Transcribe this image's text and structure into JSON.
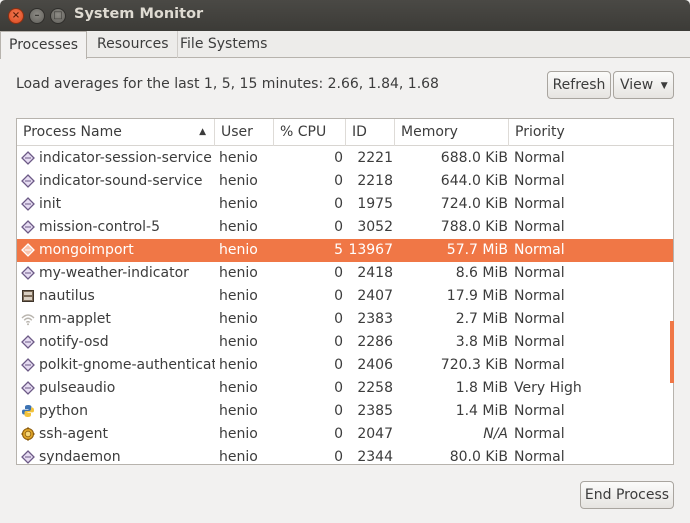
{
  "window": {
    "title": "System Monitor"
  },
  "tabs": [
    {
      "label": "Processes",
      "active": true
    },
    {
      "label": "Resources",
      "active": false
    },
    {
      "label": "File Systems",
      "active": false
    }
  ],
  "load_averages": "Load averages for the last 1, 5, 15 minutes: 2.66, 1.84, 1.68",
  "toolbar": {
    "refresh_label": "Refresh",
    "view_label": "View"
  },
  "columns": {
    "name": "Process Name",
    "user": "User",
    "cpu": "% CPU",
    "id": "ID",
    "memory": "Memory",
    "priority": "Priority"
  },
  "processes": [
    {
      "name": "indicator-session-service",
      "user": "henio",
      "cpu": "0",
      "id": "2221",
      "memory": "688.0 KiB",
      "priority": "Normal",
      "icon": "diamond-icon"
    },
    {
      "name": "indicator-sound-service",
      "user": "henio",
      "cpu": "0",
      "id": "2218",
      "memory": "644.0 KiB",
      "priority": "Normal",
      "icon": "diamond-icon"
    },
    {
      "name": "init",
      "user": "henio",
      "cpu": "0",
      "id": "1975",
      "memory": "724.0 KiB",
      "priority": "Normal",
      "icon": "diamond-icon"
    },
    {
      "name": "mission-control-5",
      "user": "henio",
      "cpu": "0",
      "id": "3052",
      "memory": "788.0 KiB",
      "priority": "Normal",
      "icon": "diamond-icon"
    },
    {
      "name": "mongoimport",
      "user": "henio",
      "cpu": "5",
      "id": "13967",
      "memory": "57.7 MiB",
      "priority": "Normal",
      "icon": "diamond-icon",
      "selected": true
    },
    {
      "name": "my-weather-indicator",
      "user": "henio",
      "cpu": "0",
      "id": "2418",
      "memory": "8.6 MiB",
      "priority": "Normal",
      "icon": "diamond-icon"
    },
    {
      "name": "nautilus",
      "user": "henio",
      "cpu": "0",
      "id": "2407",
      "memory": "17.9 MiB",
      "priority": "Normal",
      "icon": "file-cabinet-icon"
    },
    {
      "name": "nm-applet",
      "user": "henio",
      "cpu": "0",
      "id": "2383",
      "memory": "2.7 MiB",
      "priority": "Normal",
      "icon": "wifi-icon"
    },
    {
      "name": "notify-osd",
      "user": "henio",
      "cpu": "0",
      "id": "2286",
      "memory": "3.8 MiB",
      "priority": "Normal",
      "icon": "diamond-icon"
    },
    {
      "name": "polkit-gnome-authenticati",
      "user": "henio",
      "cpu": "0",
      "id": "2406",
      "memory": "720.3 KiB",
      "priority": "Normal",
      "icon": "diamond-icon"
    },
    {
      "name": "pulseaudio",
      "user": "henio",
      "cpu": "0",
      "id": "2258",
      "memory": "1.8 MiB",
      "priority": "Very High",
      "icon": "diamond-icon"
    },
    {
      "name": "python",
      "user": "henio",
      "cpu": "0",
      "id": "2385",
      "memory": "1.4 MiB",
      "priority": "Normal",
      "icon": "python-icon"
    },
    {
      "name": "ssh-agent",
      "user": "henio",
      "cpu": "0",
      "id": "2047",
      "memory": "N/A",
      "priority": "Normal",
      "icon": "key-seal-icon"
    },
    {
      "name": "syndaemon",
      "user": "henio",
      "cpu": "0",
      "id": "2344",
      "memory": "80.0 KiB",
      "priority": "Normal",
      "icon": "diamond-icon"
    }
  ],
  "footer": {
    "end_process_label": "End Process"
  },
  "colors": {
    "accent": "#f07746",
    "titlebar": "#3c3b37",
    "window_bg": "#f2f1f0"
  }
}
